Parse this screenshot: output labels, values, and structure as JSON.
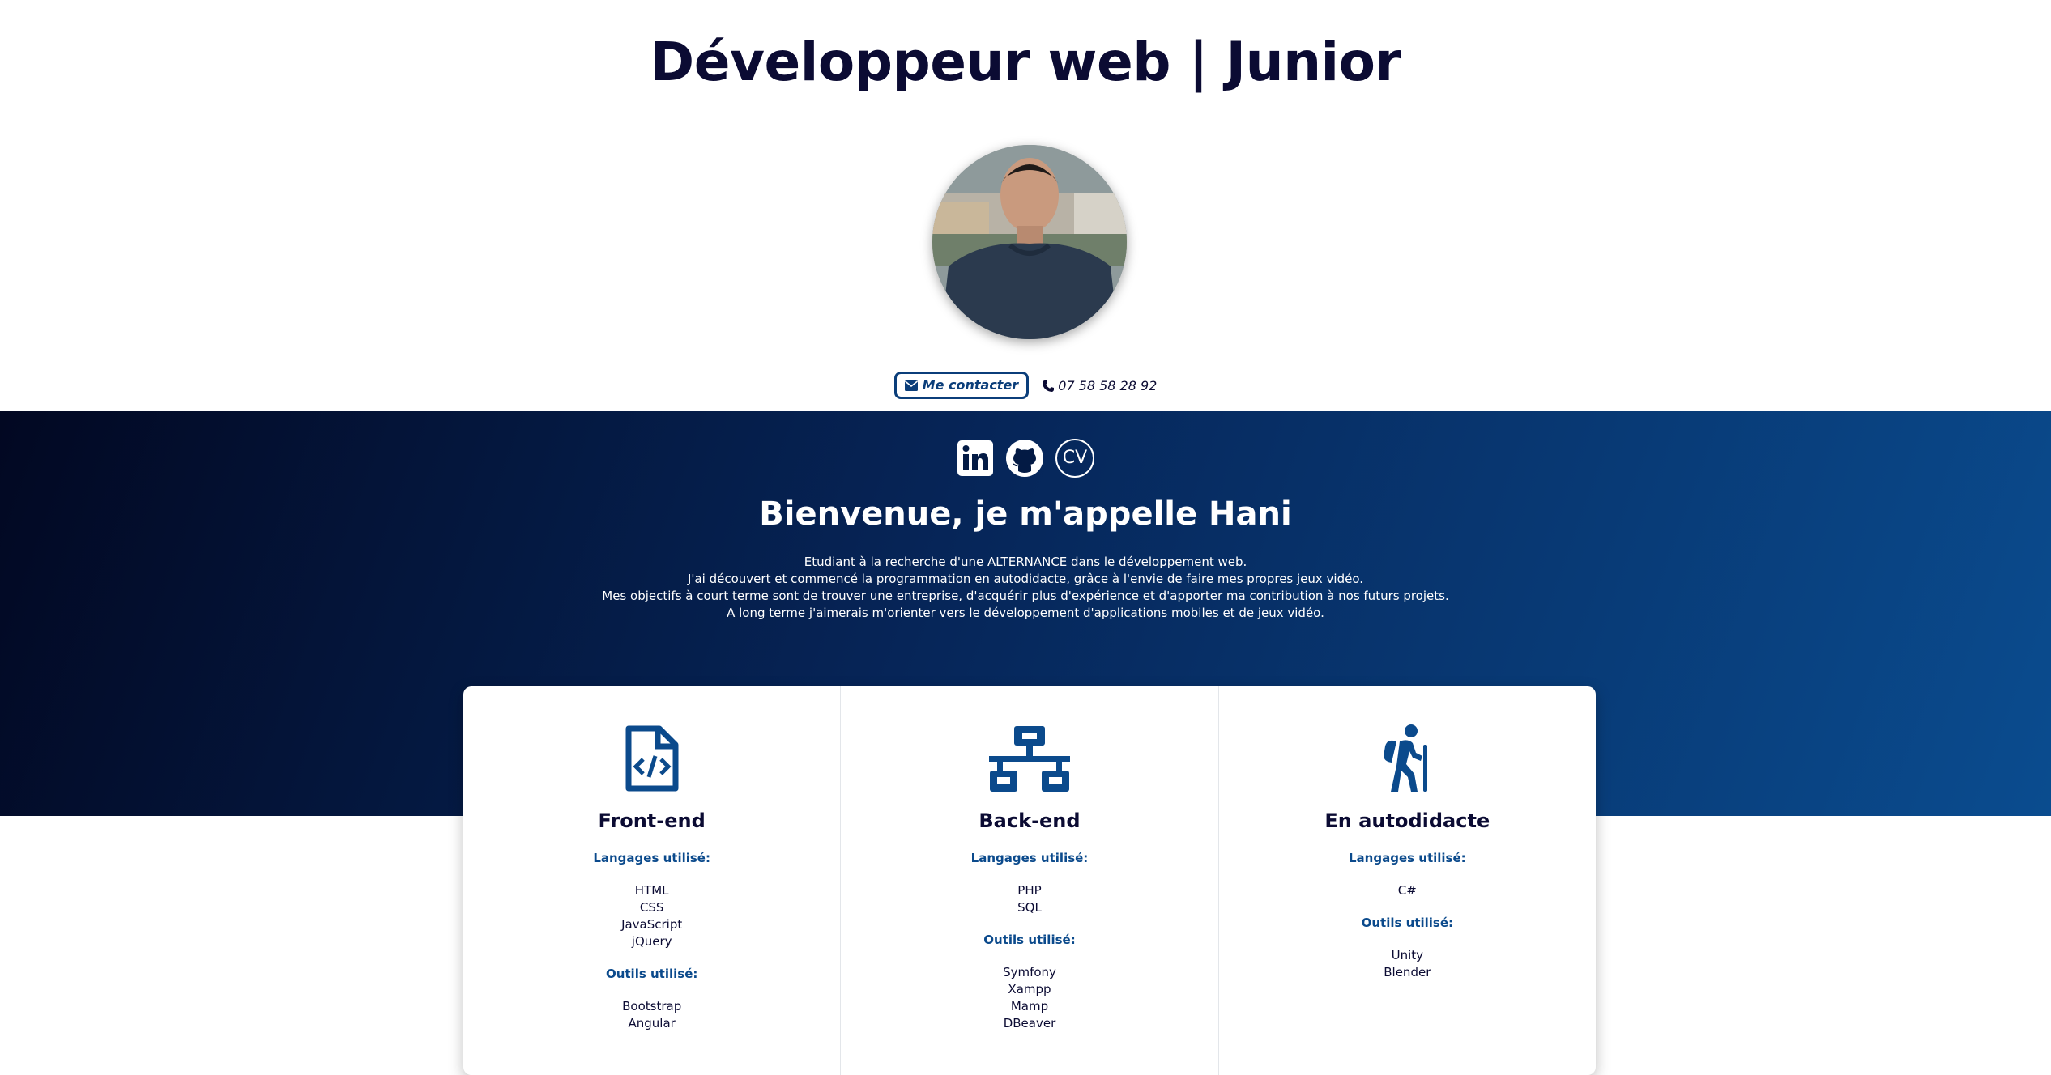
{
  "header": {
    "title": "Développeur web | Junior",
    "contact_label": "Me contacter",
    "phone": "07 58 58 28 92"
  },
  "socials": {
    "cv_label": "CV",
    "icons": [
      "linkedin-icon",
      "github-icon",
      "cv-icon"
    ]
  },
  "hero": {
    "title": "Bienvenue, je m'appelle Hani",
    "lines": [
      "Etudiant à la recherche d'une ALTERNANCE dans le développement web.",
      "J'ai découvert et commencé la programmation en autodidacte, grâce à l'envie de faire mes propres jeux vidéo.",
      "Mes objectifs à court terme sont de trouver une entreprise, d'acquérir plus d'expérience et d'apporter ma contribution à nos futurs projets.",
      "A long terme j'aimerais m'orienter vers le développement d'applications mobiles et de jeux vidéo."
    ]
  },
  "cards": [
    {
      "title": "Front-end",
      "icon": "file-code-icon",
      "lang_head": "Langages utilisé:",
      "langs": [
        "HTML",
        "CSS",
        "JavaScript",
        "jQuery"
      ],
      "tools_head": "Outils utilisé:",
      "tools": [
        "Bootstrap",
        "Angular"
      ]
    },
    {
      "title": "Back-end",
      "icon": "network-icon",
      "lang_head": "Langages utilisé:",
      "langs": [
        "PHP",
        "SQL"
      ],
      "tools_head": "Outils utilisé:",
      "tools": [
        "Symfony",
        "Xampp",
        "Mamp",
        "DBeaver"
      ]
    },
    {
      "title": "En autodidacte",
      "icon": "hiking-icon",
      "lang_head": "Langages utilisé:",
      "langs": [
        "C#"
      ],
      "tools_head": "Outils utilisé:",
      "tools": [
        "Unity",
        "Blender"
      ]
    }
  ],
  "colors": {
    "navy": "#0b0b33",
    "accent": "#0b4a8c",
    "hero_start": "#020822",
    "hero_end": "#0a4c8f"
  }
}
